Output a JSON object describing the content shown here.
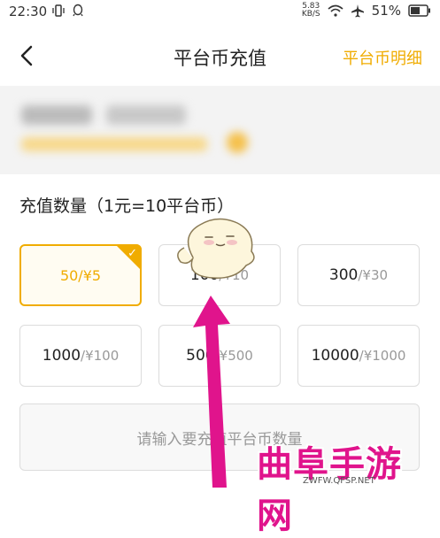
{
  "status_bar": {
    "time": "22:30",
    "net_speed_value": "5.83",
    "net_speed_unit": "KB/S",
    "battery": "51%"
  },
  "nav": {
    "title": "平台币充值",
    "right_link": "平台币明细"
  },
  "section": {
    "title": "充值数量（1元=10平台币）"
  },
  "options": [
    {
      "amount": "50",
      "price": "/¥5",
      "selected": true
    },
    {
      "amount": "100",
      "price": "/¥10",
      "selected": false
    },
    {
      "amount": "300",
      "price": "/¥30",
      "selected": false
    },
    {
      "amount": "1000",
      "price": "/¥100",
      "selected": false
    },
    {
      "amount": "500",
      "price": "/¥500",
      "selected": false
    },
    {
      "amount": "10000",
      "price": "/¥1000",
      "selected": false
    }
  ],
  "custom_input": {
    "placeholder": "请输入要充值平台币数量"
  },
  "watermark": {
    "text": "曲阜手游网",
    "url": "ZWFW.QFSP.NET"
  },
  "colors": {
    "accent": "#f0ac00",
    "arrow": "#e0148c"
  }
}
